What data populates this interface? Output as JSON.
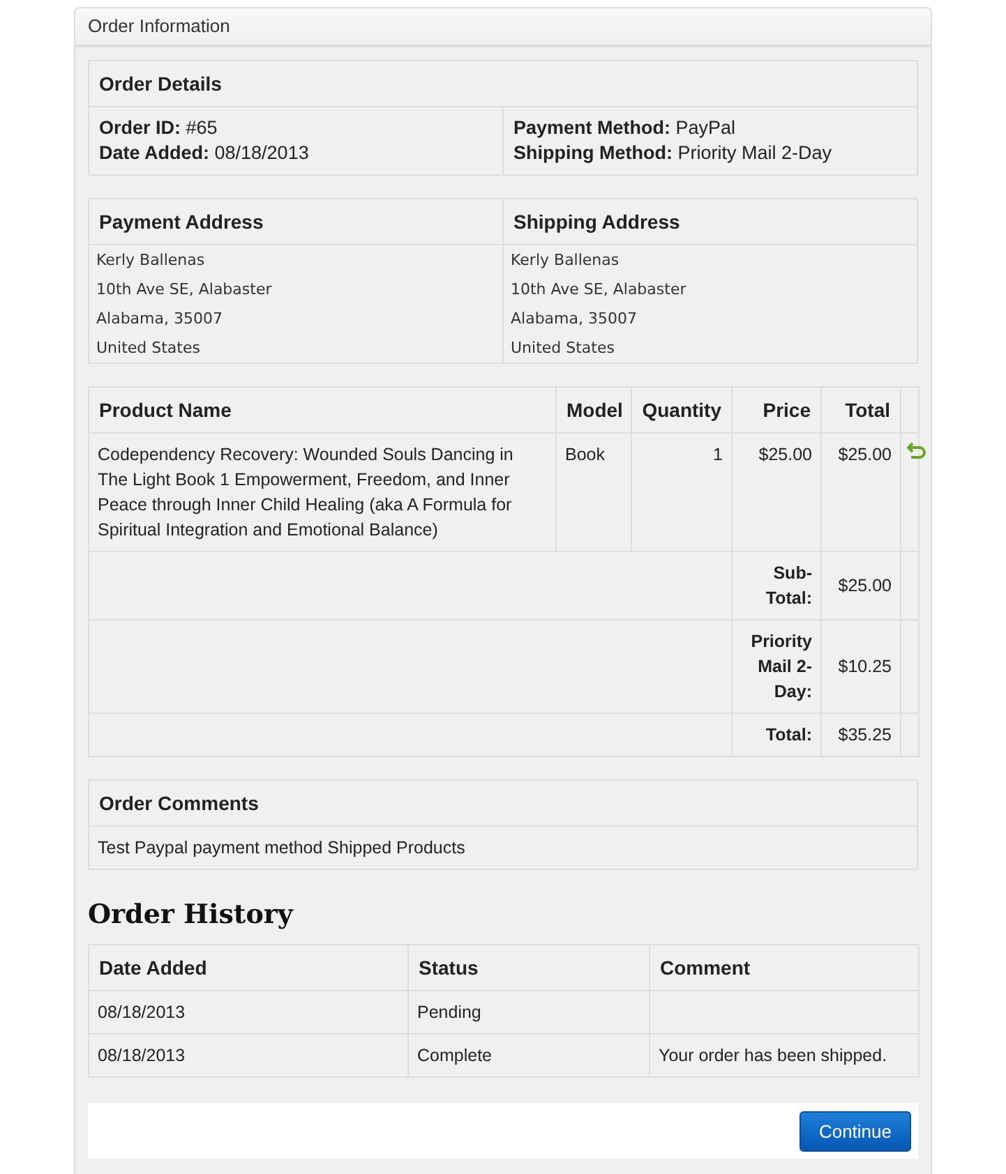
{
  "panel": {
    "title": "Order Information"
  },
  "order_details": {
    "heading": "Order Details",
    "columns": [
      [
        "**Order ID:** #65",
        "**Date Added:** 08/18/2013"
      ],
      [
        "**Payment Method:** PayPal",
        "**Shipping Method:** Priority Mail 2-Day"
      ]
    ]
  },
  "addresses": [
    {
      "heading": "Payment Address",
      "lines": [
        "Kerly Ballenas",
        "10th Ave SE, Alabaster",
        "Alabama, 35007",
        "United States"
      ]
    },
    {
      "heading": "Shipping Address",
      "lines": [
        "Kerly Ballenas",
        "10th Ave SE, Alabaster",
        "Alabama, 35007",
        "United States"
      ]
    }
  ],
  "products": {
    "columns": [
      "Product Name",
      "Model",
      "Quantity",
      "Price",
      "Total"
    ],
    "rows": [
      {
        "cells": [
          "Codependency Recovery: Wounded Souls Dancing in The Light Book 1 Empowerment, Freedom, and Inner Peace through Inner Child Healing (aka A Formula for Spiritual Integration and Emotional Balance)",
          "Book",
          "1",
          "$25.00",
          "$25.00"
        ],
        "reorder": true
      }
    ],
    "totals": [
      {
        "label": "Sub-Total:",
        "value": "$25.00"
      },
      {
        "label": "Priority Mail 2-Day:",
        "value": "$10.25"
      },
      {
        "label": "Total:",
        "value": "$35.25"
      }
    ]
  },
  "comments": {
    "heading": "Order Comments",
    "text": "Test Paypal payment method Shipped Products"
  },
  "history": {
    "title": "Order History",
    "columns": [
      "Date Added",
      "Status",
      "Comment"
    ],
    "rows": [
      [
        "08/18/2013",
        "Pending",
        ""
      ],
      [
        "08/18/2013",
        "Complete",
        "Your order has been shipped."
      ]
    ]
  },
  "continue_button": "Continue"
}
